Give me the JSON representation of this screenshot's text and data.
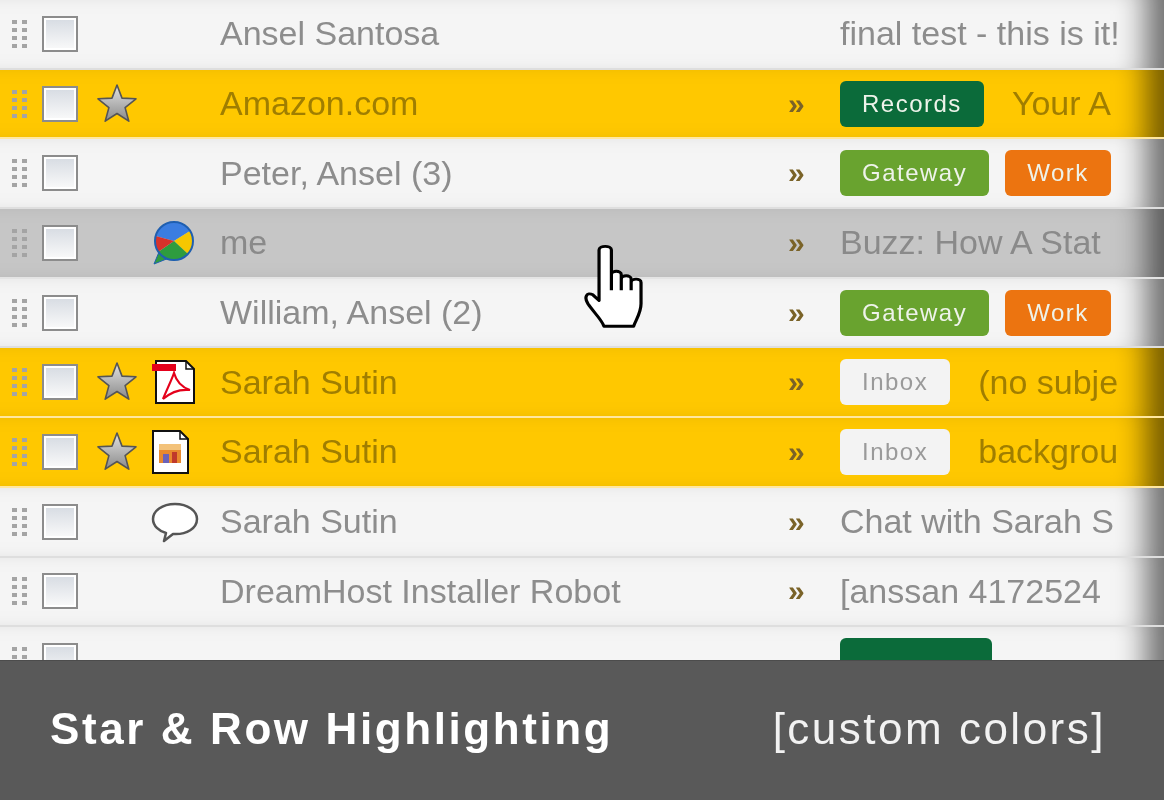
{
  "rows": [
    {
      "sender": "Ansel Santosa",
      "checked": false,
      "starred": false,
      "hovered": false,
      "kind": "mail",
      "subject": "final test - this is it!"
    },
    {
      "sender": "Amazon.com",
      "checked": false,
      "starred": true,
      "hovered": false,
      "kind": "mail",
      "level_mark": "»",
      "labels": [
        {
          "text": "Records",
          "color": "#0b6b3a"
        }
      ],
      "subject": "Your A"
    },
    {
      "sender": "Peter, Ansel (3)",
      "checked": false,
      "starred": false,
      "hovered": false,
      "kind": "mail",
      "level_mark": "»",
      "labels": [
        {
          "text": "Gateway",
          "color": "#69a32f"
        },
        {
          "text": "Work",
          "color": "#ec7410"
        }
      ]
    },
    {
      "sender": "me",
      "checked": false,
      "starred": false,
      "hovered": true,
      "kind": "buzz",
      "level_mark": "»",
      "subject": "Buzz: How A Stat"
    },
    {
      "sender": "William, Ansel (2)",
      "checked": false,
      "starred": false,
      "hovered": false,
      "kind": "mail",
      "level_mark": "»",
      "labels": [
        {
          "text": "Gateway",
          "color": "#69a32f"
        },
        {
          "text": "Work",
          "color": "#ec7410"
        }
      ]
    },
    {
      "sender": "Sarah Sutin",
      "checked": false,
      "starred": true,
      "hovered": false,
      "kind": "pdf",
      "level_mark": "»",
      "labels": [
        {
          "text": "Inbox",
          "color": "#f3f3f3"
        }
      ],
      "subject": "(no subje"
    },
    {
      "sender": "Sarah Sutin",
      "checked": false,
      "starred": true,
      "hovered": false,
      "kind": "image",
      "level_mark": "»",
      "labels": [
        {
          "text": "Inbox",
          "color": "#f3f3f3"
        }
      ],
      "subject": "backgrou"
    },
    {
      "sender": "Sarah Sutin",
      "checked": false,
      "starred": false,
      "hovered": false,
      "kind": "chat",
      "level_mark": "»",
      "subject": "Chat with Sarah S"
    },
    {
      "sender": "DreamHost Installer Robot",
      "checked": false,
      "starred": false,
      "hovered": false,
      "kind": "mail",
      "level_mark": "»",
      "subject": "[anssan 4172524"
    },
    {
      "starred": false,
      "hovered": false,
      "kind": "mail",
      "labels": [
        {
          "color": "#0b6b3a"
        }
      ]
    }
  ],
  "banner": {
    "title": "Star & Row Highlighting",
    "note": "[custom colors]"
  }
}
